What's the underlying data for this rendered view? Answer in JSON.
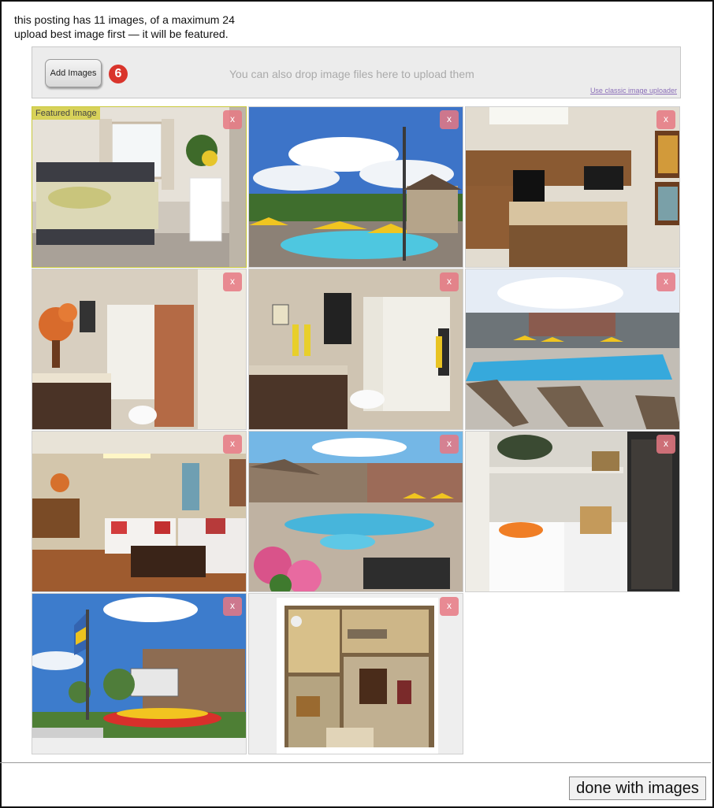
{
  "info": {
    "count_line": "this posting has 11 images, of a maximum 24",
    "hint_line": "upload best image first — it will be featured."
  },
  "uploader": {
    "add_label": "Add Images",
    "badge_count": "6",
    "drop_hint": "You can also drop image files here to upload them",
    "classic_link": "Use classic image uploader"
  },
  "grid": {
    "featured_label": "Featured Image",
    "delete_label": "x",
    "images": [
      {
        "subject": "bedroom"
      },
      {
        "subject": "pool-umbrellas"
      },
      {
        "subject": "kitchen"
      },
      {
        "subject": "bathroom-orange"
      },
      {
        "subject": "bathroom-yellow"
      },
      {
        "subject": "pool-lounge-chairs"
      },
      {
        "subject": "living-room"
      },
      {
        "subject": "pool-hot-tub"
      },
      {
        "subject": "laundry"
      },
      {
        "subject": "entrance-sign"
      },
      {
        "subject": "floor-plan"
      }
    ]
  },
  "footer": {
    "done_label": "done with images"
  }
}
